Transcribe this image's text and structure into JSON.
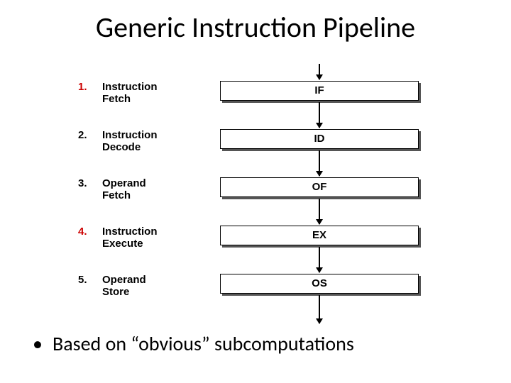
{
  "title": "Generic Instruction Pipeline",
  "stages": [
    {
      "num": "1.",
      "label_line1": "Instruction",
      "label_line2": "Fetch",
      "abbr": "IF"
    },
    {
      "num": "2.",
      "label_line1": "Instruction",
      "label_line2": "Decode",
      "abbr": "ID"
    },
    {
      "num": "3.",
      "label_line1": "Operand",
      "label_line2": "Fetch",
      "abbr": "OF"
    },
    {
      "num": "4.",
      "label_line1": "Instruction",
      "label_line2": "Execute",
      "abbr": "EX"
    },
    {
      "num": "5.",
      "label_line1": "Operand",
      "label_line2": "Store",
      "abbr": "OS"
    }
  ],
  "bullet": {
    "dot": "•",
    "text": "Based on “obvious” subcomputations"
  }
}
